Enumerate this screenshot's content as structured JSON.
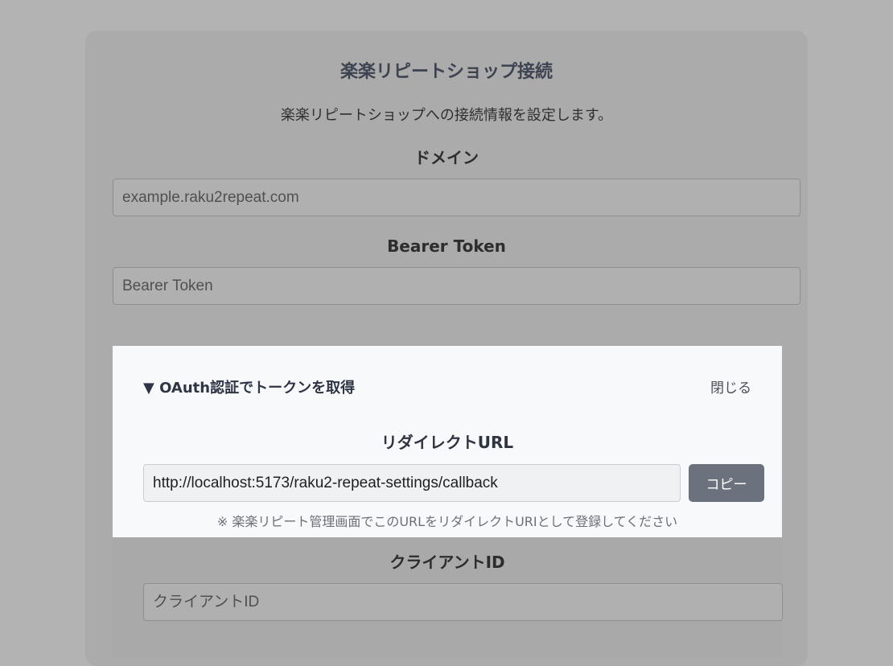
{
  "dialog": {
    "title": "楽楽リピートショップ接続",
    "description": "楽楽リピートショップへの接続情報を設定します。",
    "domain": {
      "label": "ドメイン",
      "placeholder": "example.raku2repeat.com",
      "value": ""
    },
    "bearer_token": {
      "label": "Bearer Token",
      "placeholder": "Bearer Token",
      "value": ""
    },
    "oauth": {
      "toggle_label": "▼ OAuth認証でトークンを取得",
      "close_label": "閉じる",
      "redirect_label": "リダイレクトURL",
      "redirect_url": "http://localhost:5173/raku2-repeat-settings/callback",
      "copy_label": "コピー",
      "note": "※ 楽楽リピート管理画面でこのURLをリダイレクトURIとして登録してください"
    },
    "client_id": {
      "label": "クライアントID",
      "placeholder": "クライアントID",
      "value": ""
    }
  }
}
